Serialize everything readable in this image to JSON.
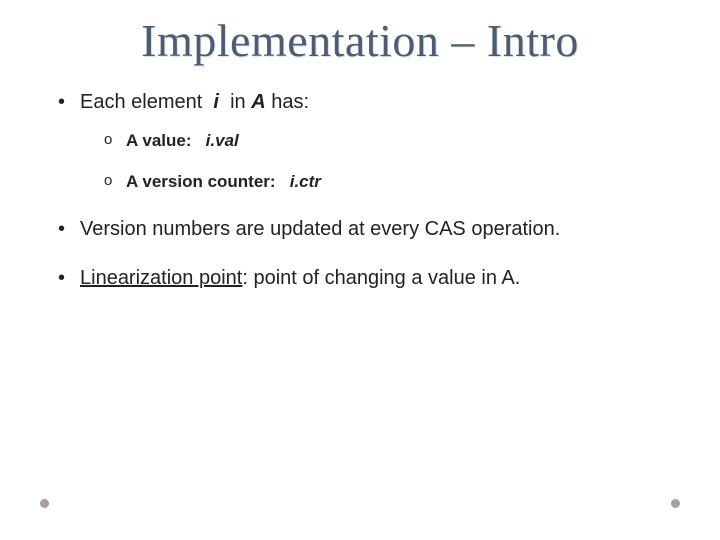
{
  "title": "Implementation – Intro",
  "bullets": {
    "b1": {
      "s1": "Each element  ",
      "s2": "i",
      "s3": "  in ",
      "s4": "A",
      "s5": " has:"
    },
    "b1a": {
      "s1": "A value:   ",
      "s2": "i.val"
    },
    "b1b": {
      "s1": "A version counter:   ",
      "s2": "i.ctr"
    },
    "b2": "Version numbers are updated at every CAS operation.",
    "b3": {
      "s1": "Linearization point",
      "s2": ": point of changing a value in A."
    }
  }
}
